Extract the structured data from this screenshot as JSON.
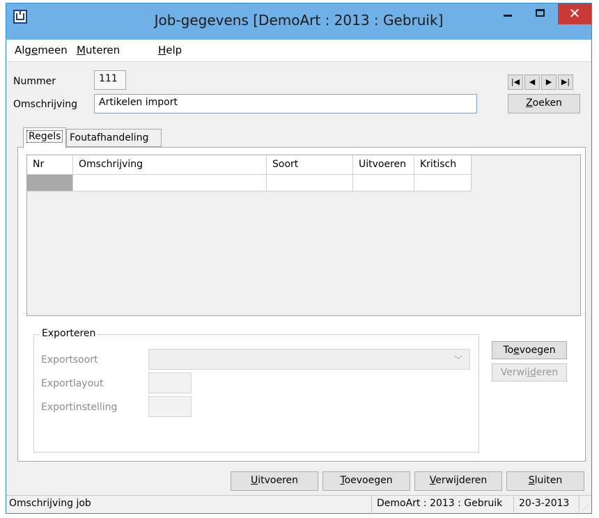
{
  "window": {
    "title": "Job-gegevens  [DemoArt : 2013 : Gebruik]",
    "minimize_icon": "minimize-icon",
    "maximize_icon": "maximize-icon",
    "close_glyph": "✕"
  },
  "menu": {
    "items": [
      {
        "pre": "Alg",
        "u": "e",
        "post": "meen"
      },
      {
        "pre": "",
        "u": "M",
        "post": "uteren"
      },
      {
        "pre": "",
        "u": "H",
        "post": "elp"
      }
    ]
  },
  "form": {
    "nummer_label": "Nummer",
    "nummer_value": "111",
    "omschrijving_label": "Omschrijving",
    "omschrijving_value": "Artikelen import"
  },
  "nav": {
    "first": "|◀",
    "prev": "◀",
    "next": "▶",
    "last": "▶|",
    "zoeken": {
      "pre": "",
      "u": "Z",
      "post": "oeken"
    }
  },
  "tabs": [
    "Regels",
    "Foutafhandeling"
  ],
  "grid": {
    "columns": [
      "Nr",
      "Omschrijving",
      "Soort",
      "Uitvoeren",
      "Kritisch"
    ]
  },
  "export": {
    "group_title": "Exporteren",
    "exportsoort_label": "Exportsoort",
    "exportlayout_label": "Exportlayout",
    "exportinstelling_label": "Exportinstelling",
    "toevoegen": {
      "pre": "To",
      "u": "e",
      "post": "voegen"
    },
    "verwijderen": {
      "pre": "Verwij",
      "u": "d",
      "post": "eren"
    }
  },
  "footer_buttons": [
    {
      "pre": "",
      "u": "U",
      "post": "itvoeren"
    },
    {
      "pre": "",
      "u": "T",
      "post": "oevoegen"
    },
    {
      "pre": "",
      "u": "V",
      "post": "erwijderen"
    },
    {
      "pre": "",
      "u": "S",
      "post": "luiten"
    }
  ],
  "status": {
    "left": "Omschrijving job",
    "context": "DemoArt : 2013 : Gebruik",
    "date": "20-3-2013"
  }
}
